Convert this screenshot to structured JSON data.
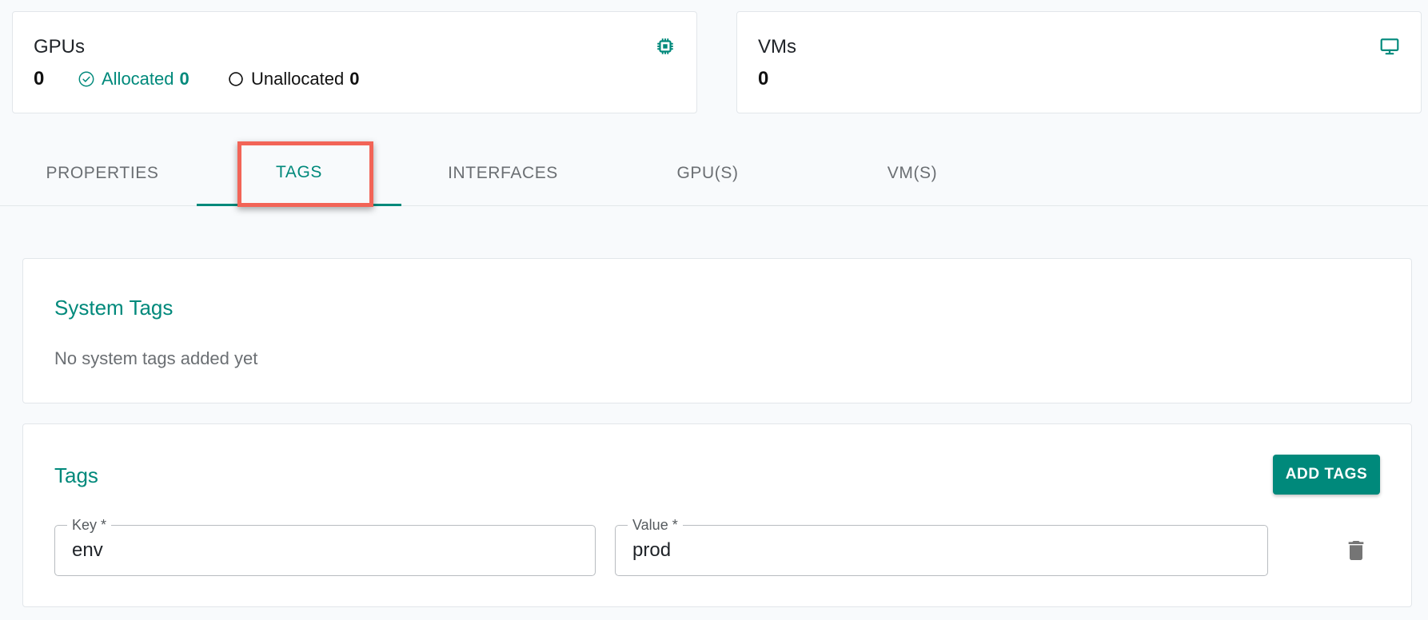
{
  "summary": {
    "gpus": {
      "title": "GPUs",
      "count": "0",
      "allocated_label": "Allocated",
      "allocated_count": "0",
      "unallocated_label": "Unallocated",
      "unallocated_count": "0",
      "icon": "chip-icon"
    },
    "vms": {
      "title": "VMs",
      "count": "0",
      "icon": "monitor-icon"
    }
  },
  "tabs": [
    {
      "label": "PROPERTIES",
      "active": false
    },
    {
      "label": "TAGS",
      "active": true
    },
    {
      "label": "INTERFACES",
      "active": false
    },
    {
      "label": "GPU(S)",
      "active": false
    },
    {
      "label": "VM(S)",
      "active": false
    }
  ],
  "system_tags": {
    "title": "System Tags",
    "empty_message": "No system tags added yet"
  },
  "tags": {
    "title": "Tags",
    "add_button_label": "ADD TAGS",
    "rows": [
      {
        "key_label": "Key *",
        "key_value": "env",
        "value_label": "Value *",
        "value_value": "prod",
        "delete_icon": "trash-icon"
      }
    ]
  },
  "colors": {
    "accent": "#00897b",
    "highlight_box": "#f26457",
    "background": "#f8fafc"
  }
}
